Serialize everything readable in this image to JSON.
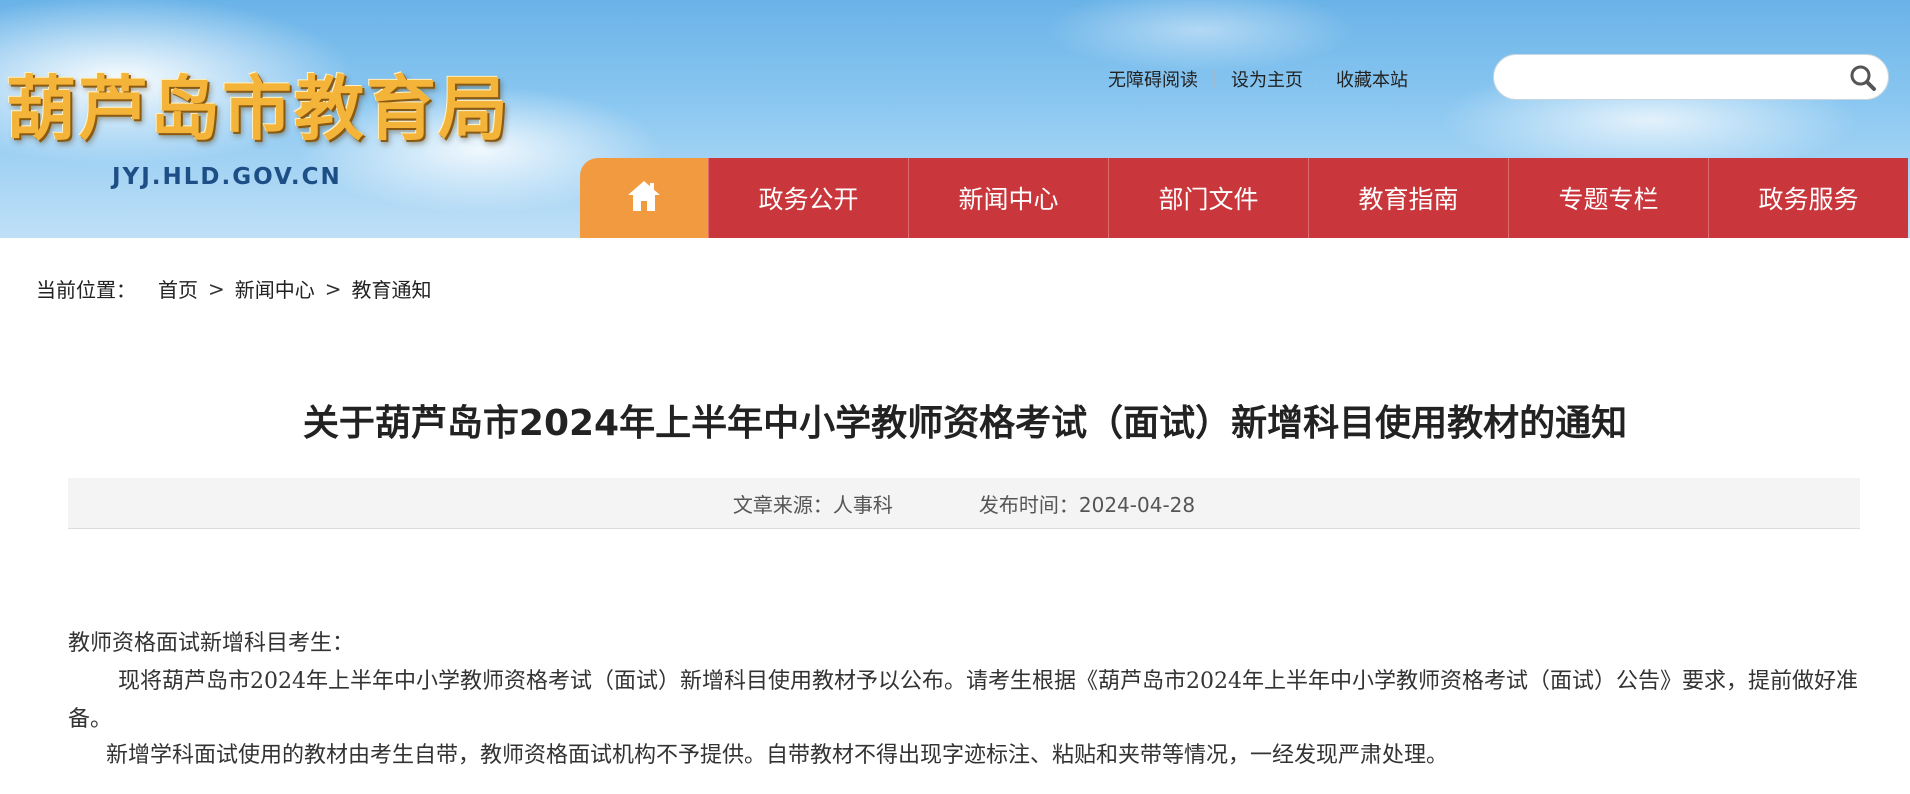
{
  "header": {
    "logo_text": "葫芦岛市教育局",
    "logo_url": "JYJ.HLD.GOV.CN",
    "top_links": [
      "无障碍阅读",
      "设为主页",
      "收藏本站"
    ],
    "search": {
      "placeholder": "",
      "value": ""
    }
  },
  "nav": {
    "home_icon": "home-icon",
    "items": [
      "政务公开",
      "新闻中心",
      "部门文件",
      "教育指南",
      "专题专栏",
      "政务服务"
    ]
  },
  "breadcrumb": {
    "label": "当前位置：",
    "items": [
      "首页",
      "新闻中心",
      "教育通知"
    ],
    "separator": ">"
  },
  "article": {
    "title": "关于葫芦岛市2024年上半年中小学教师资格考试（面试）新增科目使用教材的通知",
    "source_label": "文章来源：人事科",
    "date_label": "发布时间：2024-04-28",
    "paragraphs": [
      "教师资格面试新增科目考生：",
      "现将葫芦岛市2024年上半年中小学教师资格考试（面试）新增科目使用教材予以公布。请考生根据《葫芦岛市2024年上半年中小学教师资格考试（面试）公告》要求，提前做好准备。",
      "新增学科面试使用的教材由考生自带，教师资格面试机构不予提供。自带教材不得出现字迹标注、粘贴和夹带等情况，一经发现严肃处理。"
    ]
  },
  "colors": {
    "nav_red": "#c9363b",
    "nav_home_orange": "#f29a3f",
    "logo_gold": "#f4b43a",
    "logo_url_blue": "#1d4f86"
  }
}
